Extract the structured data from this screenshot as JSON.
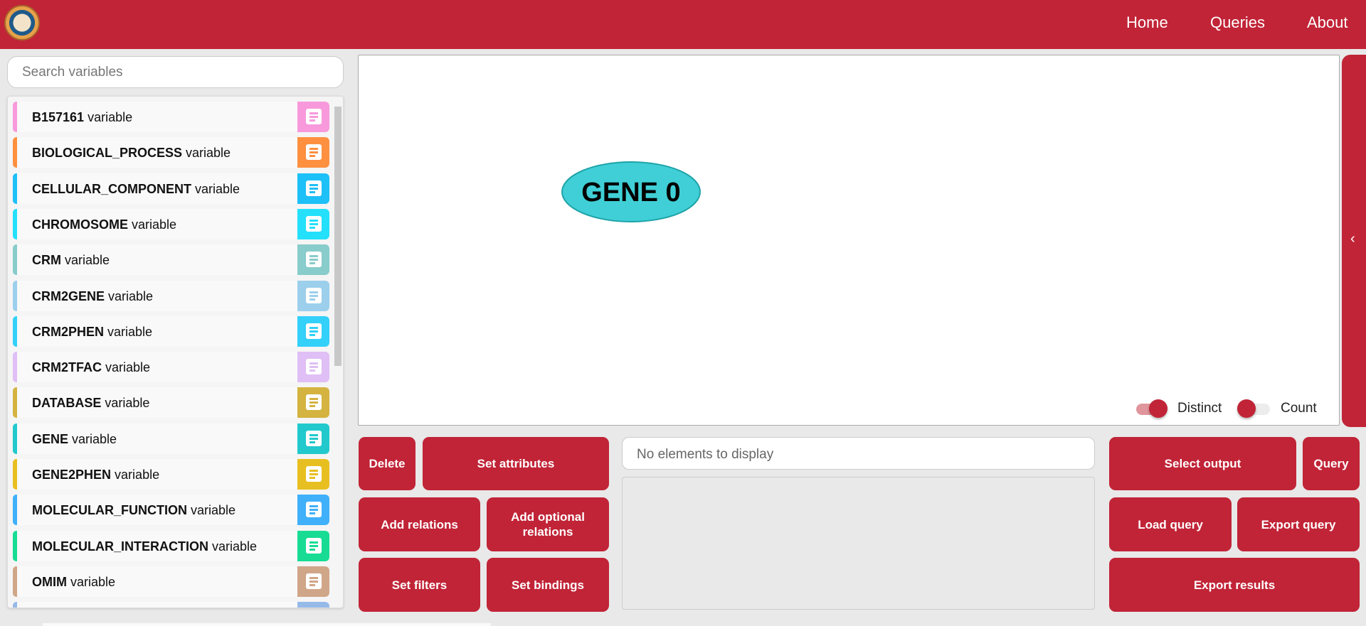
{
  "header": {
    "logo_text": "Universidad de Murcia seal",
    "nav": [
      "Home",
      "Queries",
      "About"
    ]
  },
  "search": {
    "placeholder": "Search variables"
  },
  "variables": [
    {
      "name": "B157161",
      "suffix": " variable",
      "color": "#f899dc"
    },
    {
      "name": "BIOLOGICAL_PROCESS",
      "suffix": " variable",
      "color": "#fe9040"
    },
    {
      "name": "CELLULAR_COMPONENT",
      "suffix": " variable",
      "color": "#1ec0f8"
    },
    {
      "name": "CHROMOSOME",
      "suffix": " variable",
      "color": "#24e0fb"
    },
    {
      "name": "CRM",
      "suffix": " variable",
      "color": "#88cccb"
    },
    {
      "name": "CRM2GENE",
      "suffix": " variable",
      "color": "#9ccfec"
    },
    {
      "name": "CRM2PHEN",
      "suffix": " variable",
      "color": "#33d0fa"
    },
    {
      "name": "CRM2TFAC",
      "suffix": " variable",
      "color": "#dfbff5"
    },
    {
      "name": "DATABASE",
      "suffix": " variable",
      "color": "#d4b340"
    },
    {
      "name": "GENE",
      "suffix": " variable",
      "color": "#22c9cc"
    },
    {
      "name": "GENE2PHEN",
      "suffix": " variable",
      "color": "#e8bf20"
    },
    {
      "name": "MOLECULAR_FUNCTION",
      "suffix": " variable",
      "color": "#40b0fa"
    },
    {
      "name": "MOLECULAR_INTERACTION",
      "suffix": " variable",
      "color": "#18dc94"
    },
    {
      "name": "OMIM",
      "suffix": " variable",
      "color": "#d0a688"
    },
    {
      "name": "",
      "suffix": "",
      "color": "#96bae8"
    }
  ],
  "graph": {
    "node_label": "GENE 0",
    "node_color": "#40cfd6"
  },
  "toggles": {
    "distinct": {
      "label": "Distinct",
      "on": true
    },
    "count": {
      "label": "Count",
      "on": false
    }
  },
  "buttons": {
    "delete": "Delete",
    "set_attributes": "Set attributes",
    "add_relations": "Add relations",
    "add_optional_relations": "Add optional relations",
    "set_filters": "Set filters",
    "set_bindings": "Set bindings",
    "select_output": "Select output",
    "query": "Query",
    "load_query": "Load query",
    "export_query": "Export query",
    "export_results": "Export results"
  },
  "results": {
    "message": "No elements to display"
  },
  "colors": {
    "brand": "#c12437"
  }
}
